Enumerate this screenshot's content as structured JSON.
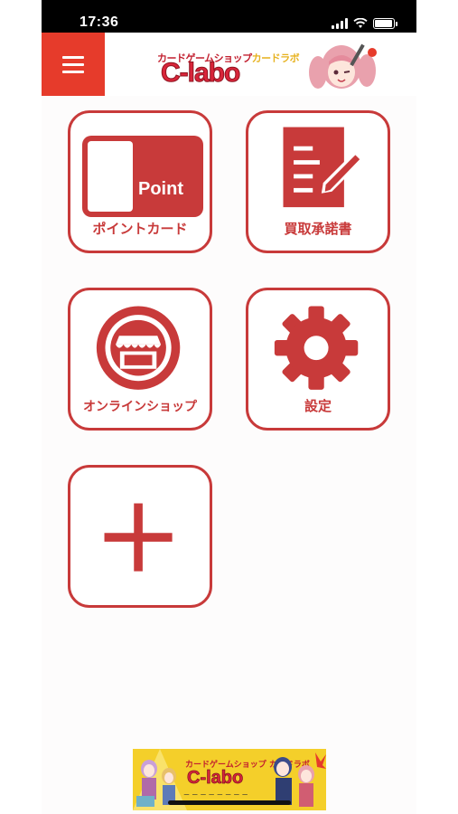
{
  "status_bar": {
    "time": "17:36",
    "battery_level": 0.95
  },
  "header": {
    "logo_sub_left": "カードゲームショップ",
    "logo_sub_right": "カードラボ",
    "logo_main": "C-labo"
  },
  "tiles": [
    {
      "label": "ポイントカード",
      "icon": "point-card-icon",
      "icon_text": "Point"
    },
    {
      "label": "買取承諾書",
      "icon": "document-pen-icon"
    },
    {
      "label": "オンラインショップ",
      "icon": "storefront-icon"
    },
    {
      "label": "設定",
      "icon": "gear-icon"
    },
    {
      "label": "",
      "icon": "plus-icon"
    }
  ],
  "banner": {
    "sub_top": "カードゲームショップ カードラボ",
    "main": "C-labo",
    "sub_bottom": "ー ー ー ー ー ー ー ー"
  },
  "colors": {
    "accent": "#e63b2b",
    "tile_border": "#c83a3a",
    "banner_bg": "#f4cf2a"
  }
}
